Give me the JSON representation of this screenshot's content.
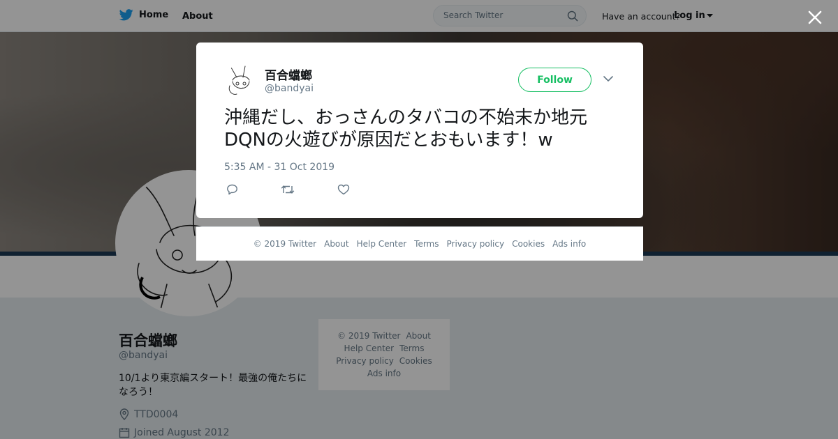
{
  "topbar": {
    "home_label": "Home",
    "about_label": "About",
    "search_placeholder": "Search Twitter",
    "account_prompt": "Have an account?",
    "login_label": "Log in"
  },
  "profile": {
    "name": "百合蟷螂",
    "handle": "@bandyai",
    "bio": "10/1より東京編スタート！最強の俺たちになろう！",
    "location": "TTD0004",
    "joined": "Joined August 2012"
  },
  "side_footer": {
    "items": [
      "© 2019 Twitter",
      "About",
      "Help Center",
      "Terms",
      "Privacy policy",
      "Cookies",
      "Ads info"
    ]
  },
  "tweet": {
    "author_name": "百合蟷螂",
    "author_handle": "@bandyai",
    "follow_label": "Follow",
    "text": "沖縄だし、おっさんのタバコの不始末か地元DQNの火遊びが原因だとおもいます！w",
    "timestamp": "5:35 AM - 31 Oct 2019"
  },
  "modal_footer": {
    "items": [
      "© 2019 Twitter",
      "About",
      "Help Center",
      "Terms",
      "Privacy policy",
      "Cookies",
      "Ads info"
    ]
  },
  "colors": {
    "accent": "#1da1f2",
    "follow_green": "#17bf63",
    "muted_text": "#657786"
  },
  "icons": {
    "brand": "twitter-bird-icon",
    "search": "search-icon",
    "close": "close-icon",
    "reply": "reply-icon",
    "retweet": "retweet-icon",
    "like": "heart-icon",
    "location": "location-pin-icon",
    "calendar": "calendar-icon",
    "more": "chevron-down-icon"
  }
}
